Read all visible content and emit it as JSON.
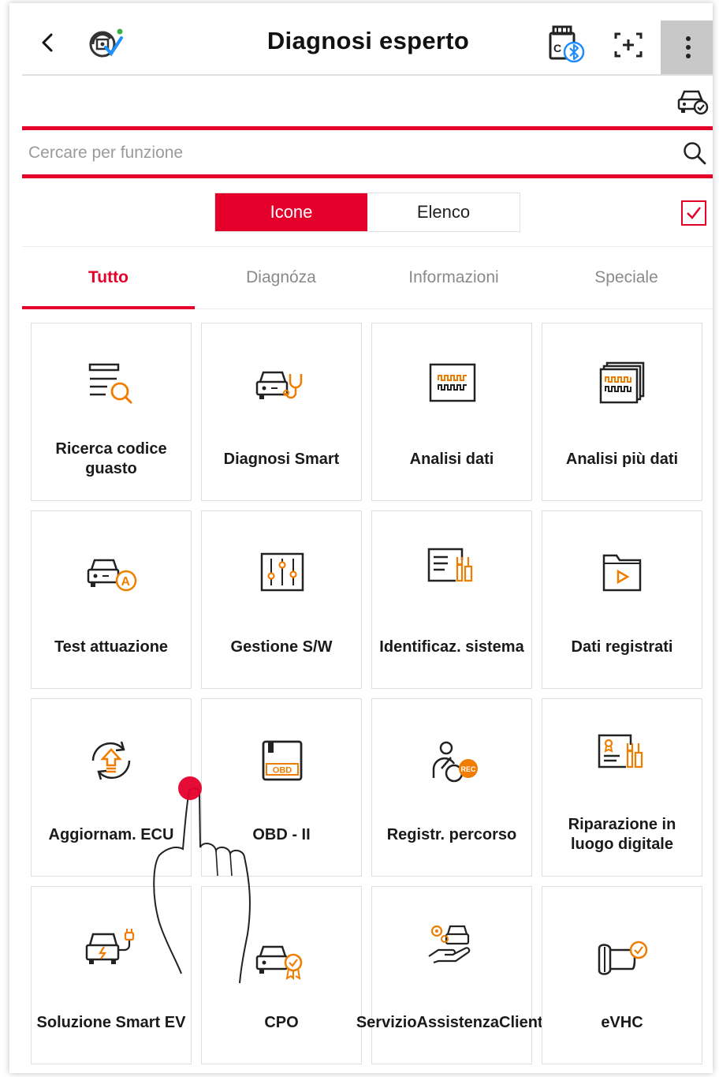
{
  "header": {
    "title": "Diagnosi esperto",
    "icons": {
      "back": "chevron-left-icon",
      "vci": "vci-connected-icon",
      "bluetooth": "bluetooth-device-icon",
      "screenshot": "screen-capture-icon",
      "more": "more-vertical-icon"
    }
  },
  "vehicle_check_icon": "vehicle-check-icon",
  "search": {
    "placeholder": "Cercare per funzione",
    "value": ""
  },
  "view_toggle": {
    "options": [
      "Icone",
      "Elenco"
    ],
    "selected": "Icone"
  },
  "tabs": [
    "Tutto",
    "Diagnóza",
    "Informazioni",
    "Speciale"
  ],
  "active_tab": "Tutto",
  "tiles": [
    {
      "label": "Ricerca codice guasto",
      "icon": "fault-code-search-icon"
    },
    {
      "label": "Diagnosi Smart",
      "icon": "smart-diagnosis-icon"
    },
    {
      "label": "Analisi dati",
      "icon": "data-analysis-icon"
    },
    {
      "label": "Analisi più dati",
      "icon": "multi-data-analysis-icon"
    },
    {
      "label": "Test attuazione",
      "icon": "actuation-test-icon"
    },
    {
      "label": "Gestione S/W",
      "icon": "software-management-icon"
    },
    {
      "label": "Identificaz. sistema",
      "icon": "system-identification-icon"
    },
    {
      "label": "Dati registrati",
      "icon": "recorded-data-icon"
    },
    {
      "label": "Aggiornam. ECU",
      "icon": "ecu-update-icon"
    },
    {
      "label": "OBD - II",
      "icon": "obd-icon"
    },
    {
      "label": "Registr. percorso",
      "icon": "drive-record-icon"
    },
    {
      "label": "Riparazione in luogo digitale",
      "icon": "digital-repair-icon"
    },
    {
      "label": "Soluzione Smart EV",
      "icon": "smart-ev-icon"
    },
    {
      "label": "CPO",
      "icon": "cpo-icon"
    },
    {
      "label": "ServizioAssistenzaClienti",
      "icon": "customer-service-icon"
    },
    {
      "label": "eVHC",
      "icon": "evhc-icon"
    }
  ],
  "colors": {
    "accent": "#e4002b",
    "icon_orange": "#f07d00",
    "icon_dark": "#222222"
  }
}
